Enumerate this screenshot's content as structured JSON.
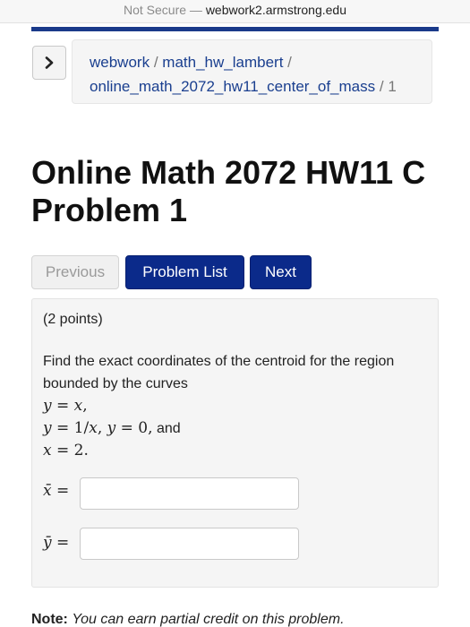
{
  "browser": {
    "security": "Not Secure",
    "separator": "—",
    "domain": "webwork2.armstrong.edu"
  },
  "breadcrumb": {
    "items": [
      "webwork",
      "math_hw_lambert",
      "online_math_2072_hw11_center_of_mass"
    ],
    "divider": "/",
    "current": "1"
  },
  "title": {
    "line1": "Online Math 2072 HW11 C",
    "line2": "Problem 1"
  },
  "nav": {
    "previous": "Previous",
    "problem_list": "Problem List",
    "next": "Next"
  },
  "problem": {
    "points": "(2 points)",
    "text": "Find the exact coordinates of the centroid for the region bounded by the curves",
    "c1_lhs": "y",
    "c1_eq": " = ",
    "c1_rhs": "x",
    "c1_end": ",",
    "c2_lhs": "y",
    "c2_eq": " = 1/",
    "c2_rhs": "x",
    "c2_end": ", ",
    "c3_lhs": "y",
    "c3_rest": " = 0,",
    "and": " and",
    "c4_lhs": "x",
    "c4_rest": " = 2.",
    "xbar_label": "x̄ =",
    "ybar_label": "ȳ =",
    "xbar_value": "",
    "ybar_value": ""
  },
  "note": {
    "label": "Note:",
    "text": "You can earn partial credit on this problem."
  }
}
